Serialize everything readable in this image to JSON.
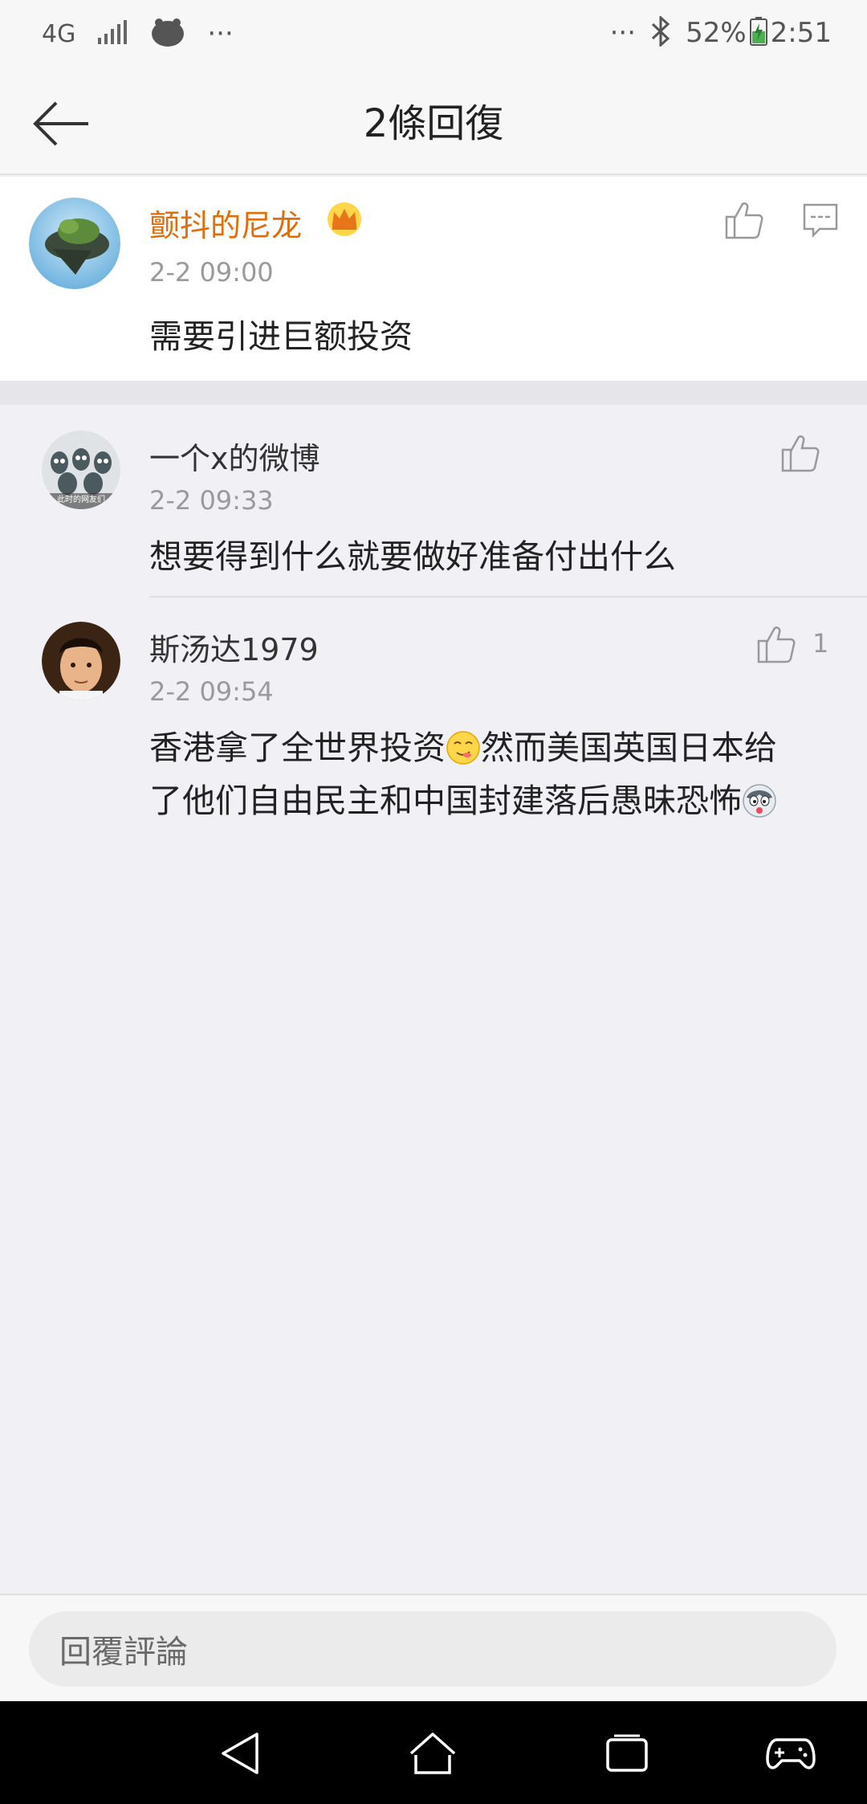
{
  "status_bar": {
    "network": "4G",
    "left_more": "···",
    "right_more": "···",
    "battery": "52%",
    "time": "2:51"
  },
  "header": {
    "title": "2條回復"
  },
  "main_comment": {
    "username": "颤抖的尼龙",
    "timestamp": "2-2 09:00",
    "text": "需要引进巨额投资"
  },
  "replies": [
    {
      "username": "一个x的微博",
      "timestamp": "2-2 09:33",
      "text": "想要得到什么就要做好准备付出什么",
      "avatar_caption": "此时的网友们",
      "likes": ""
    },
    {
      "username": "斯汤达1979",
      "timestamp": "2-2 09:54",
      "text_part1": "香港拿了全世界投资",
      "text_part2": "然而美国英国日本给",
      "text_part3": "了他们自由民主和中国封建落后愚昧恐怖",
      "likes": "1"
    }
  ],
  "input": {
    "placeholder": "回覆評論"
  },
  "colors": {
    "accent_orange": "#e06c0a",
    "background": "#f1f1f5"
  }
}
